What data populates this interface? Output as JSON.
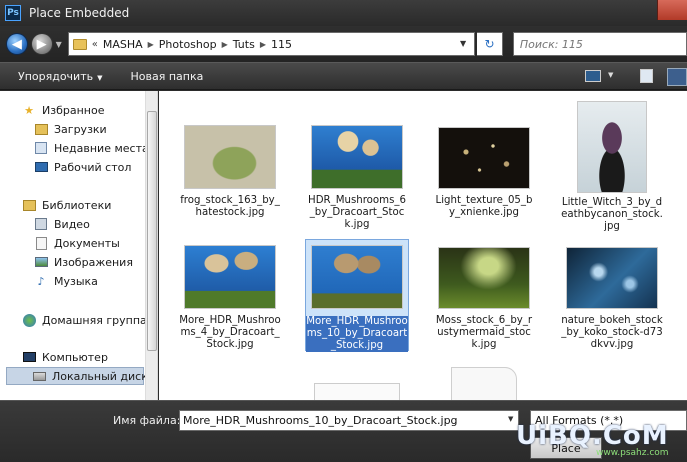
{
  "title_bar": {
    "app_icon_text": "Ps",
    "title": "Place Embedded"
  },
  "address_bar": {
    "breadcrumb_prefix": "«",
    "breadcrumbs": [
      "MASHA",
      "Photoshop",
      "Tuts",
      "115"
    ],
    "search_placeholder": "Поиск: 115"
  },
  "toolbar": {
    "organize_label": "Упорядочить",
    "new_folder_label": "Новая папка"
  },
  "sidebar": {
    "items": [
      {
        "label": "Избранное",
        "icon": "star-icon",
        "level": 0
      },
      {
        "label": "Загрузки",
        "icon": "downloads-folder-icon",
        "level": 1
      },
      {
        "label": "Недавние места",
        "icon": "recent-places-icon",
        "level": 1
      },
      {
        "label": "Рабочий стол",
        "icon": "desktop-icon",
        "level": 1
      },
      {
        "label": "Библиотеки",
        "icon": "libraries-icon",
        "level": 0
      },
      {
        "label": "Видео",
        "icon": "video-library-icon",
        "level": 1
      },
      {
        "label": "Документы",
        "icon": "documents-library-icon",
        "level": 1
      },
      {
        "label": "Изображения",
        "icon": "pictures-library-icon",
        "level": 1
      },
      {
        "label": "Музыка",
        "icon": "music-note-icon",
        "level": 1
      },
      {
        "label": "Домашняя группа",
        "icon": "homegroup-icon",
        "level": 0
      },
      {
        "label": "Компьютер",
        "icon": "computer-icon",
        "level": 0
      },
      {
        "label": "Локальный диск",
        "icon": "local-disk-icon",
        "level": 1
      }
    ]
  },
  "files": [
    {
      "caption": "frog_stock_163_by_hatestock.jpg",
      "thumb": "frog"
    },
    {
      "caption": "HDR_Mushrooms_6_by_Dracoart_Stock.jpg",
      "thumb": "mushrooms"
    },
    {
      "caption": "Light_texture_05_by_xnienke.jpg",
      "thumb": "lights"
    },
    {
      "caption": "Little_Witch_3_by_deathbycanon_stock.jpg",
      "thumb": "witch"
    },
    {
      "caption": "More_HDR_Mushrooms_4_by_Dracoart_Stock.jpg",
      "thumb": "mushrooms2"
    },
    {
      "caption": "More_HDR_Mushrooms_10_by_Dracoart_Stock.jpg",
      "thumb": "mushrooms3",
      "selected": true
    },
    {
      "caption": "Moss_stock_6_by_rustymermaid_stock.jpg",
      "thumb": "moss"
    },
    {
      "caption": "nature_bokeh_stock_by_koko_stock-d73dkvv.jpg",
      "thumb": "bokeh"
    }
  ],
  "bottom_bar": {
    "filename_label": "Имя файла:",
    "filename_value": "More_HDR_Mushrooms_10_by_Dracoart_Stock.jpg",
    "format_value": "All Formats (*.*)",
    "place_button": "Place"
  },
  "watermark": {
    "text": "UiBQ.CoM",
    "subtext": "www.psahz.com"
  }
}
